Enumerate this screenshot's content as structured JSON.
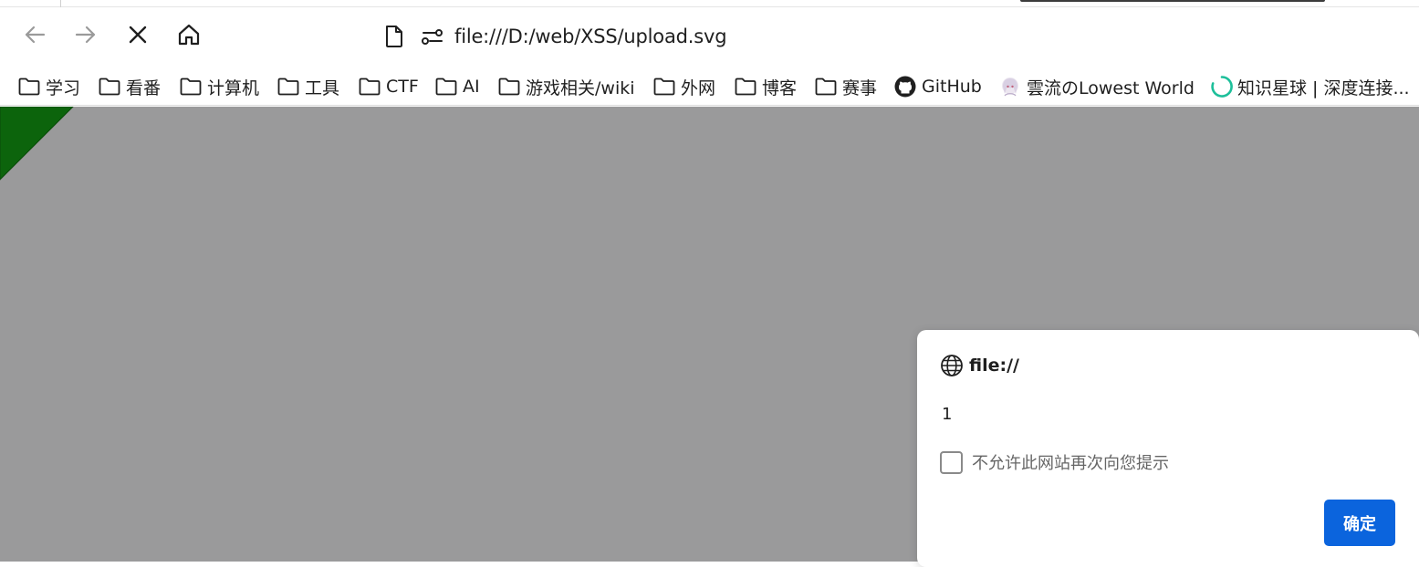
{
  "browser": {
    "address_bar": {
      "url": "file:///D:/web/XSS/upload.svg"
    },
    "bookmarks": [
      {
        "label": "学习",
        "icon": "folder-icon"
      },
      {
        "label": "看番",
        "icon": "folder-icon"
      },
      {
        "label": "计算机",
        "icon": "folder-icon"
      },
      {
        "label": "工具",
        "icon": "folder-icon"
      },
      {
        "label": "CTF",
        "icon": "folder-icon"
      },
      {
        "label": "AI",
        "icon": "folder-icon"
      },
      {
        "label": "游戏相关/wiki",
        "icon": "folder-icon"
      },
      {
        "label": "外网",
        "icon": "folder-icon"
      },
      {
        "label": "博客",
        "icon": "folder-icon"
      },
      {
        "label": "赛事",
        "icon": "folder-icon"
      },
      {
        "label": "GitHub",
        "icon": "github-icon"
      },
      {
        "label": "雲流のLowest World",
        "icon": "avatar-icon"
      },
      {
        "label": "知识星球 | 深度连接...",
        "icon": "loading-ring-icon"
      }
    ]
  },
  "page": {
    "background_color": "#9a9a9b",
    "triangle_color": "#0c640c"
  },
  "dialog": {
    "origin": "file://",
    "message": "1",
    "checkbox_label": "不允许此网站再次向您提示",
    "checkbox_checked": false,
    "ok_label": "确定",
    "ok_color": "#0b64dd"
  }
}
